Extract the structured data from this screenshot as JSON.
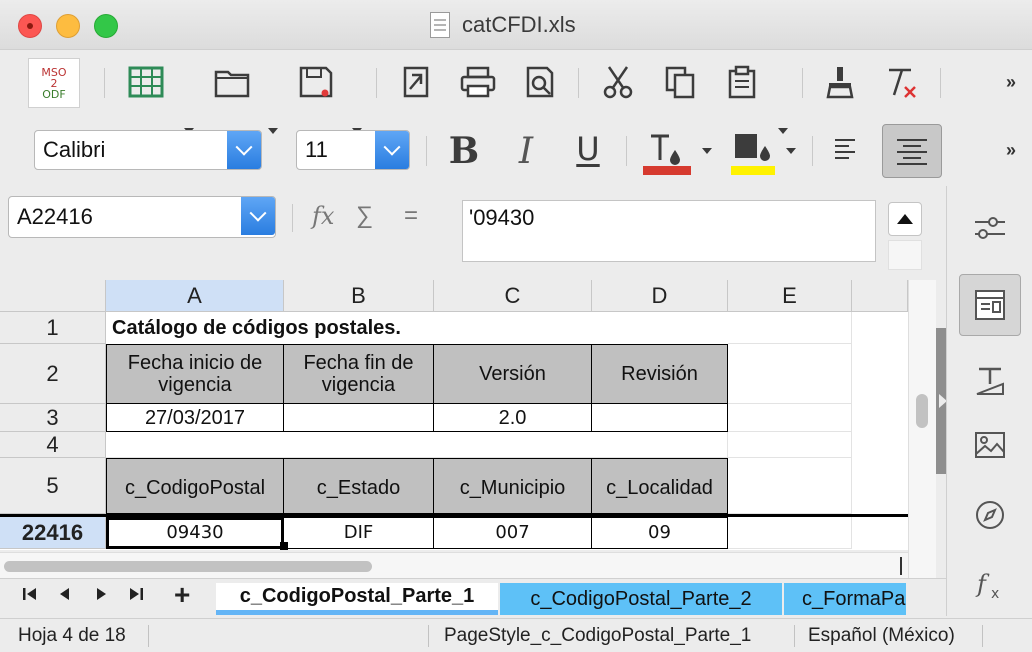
{
  "window": {
    "title": "catCFDI.xls"
  },
  "toolbar": {
    "mso_logo": [
      "MSO",
      "2",
      "ODF"
    ],
    "font_name": "Calibri",
    "font_size": "11",
    "bold_label": "B",
    "italic_label": "I",
    "underline_label": "U",
    "font_color": "#d63a2f",
    "highlight_color": "#fff200"
  },
  "formula_bar": {
    "name_box": "A22416",
    "fx_symbol": "fx",
    "sum_symbol": "∑",
    "equals_symbol": "=",
    "content": "'09430"
  },
  "sheet": {
    "columns": [
      "A",
      "B",
      "C",
      "D",
      "E"
    ],
    "selected_column": "A",
    "rows": [
      {
        "label": "1"
      },
      {
        "label": "2"
      },
      {
        "label": "3"
      },
      {
        "label": "4"
      },
      {
        "label": "5"
      },
      {
        "label": "22416"
      }
    ],
    "selected_row": "22416",
    "cells": {
      "a1": "Catálogo de códigos postales.",
      "a2": "Fecha inicio de vigencia",
      "b2": "Fecha fin de vigencia",
      "c2": "Versión",
      "d2": "Revisión",
      "a3": "27/03/2017",
      "b3": "",
      "c3": "2.0",
      "d3": "",
      "a5": "c_CodigoPostal",
      "b5": "c_Estado",
      "c5": "c_Municipio",
      "d5": "c_Localidad",
      "a22416": "09430",
      "b22416": "DIF",
      "c22416": "007",
      "d22416": "09"
    }
  },
  "tabs": {
    "items": [
      {
        "label": "c_CodigoPostal_Parte_1"
      },
      {
        "label": "c_CodigoPostal_Parte_2"
      },
      {
        "label": "c_FormaPa"
      }
    ],
    "add_label": "+"
  },
  "status": {
    "sheet_count": "Hoja 4 de 18",
    "page_style": "PageStyle_c_CodigoPostal_Parte_1",
    "language": "Español (México)"
  }
}
